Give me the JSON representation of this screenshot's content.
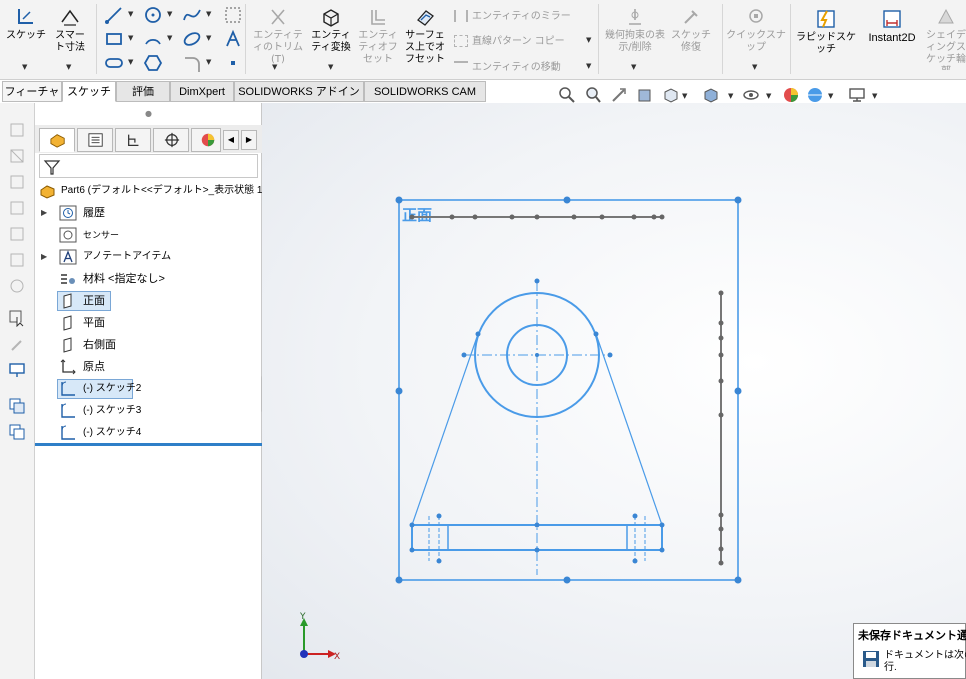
{
  "ribbon": {
    "sketch": "スケッチ",
    "smart_dim": "スマート寸法",
    "trim": "エンティティのトリム(T)",
    "convert": "エンティティ変換",
    "offset_ent": "エンティティオフセット",
    "surface_offset": "サーフェス上でオフセット",
    "mirror": "エンティティのミラー",
    "linear_pattern": "直線パターン コピー",
    "move": "エンティティの移動",
    "relations": "幾何拘束の表示/削除",
    "repair": "スケッチ修復",
    "quick_snap": "クイックスナップ",
    "rapid_sketch": "ラピッドスケッチ",
    "instant2d": "Instant2D",
    "shaded": "シェイディングスケッチ輪郭"
  },
  "tabs": [
    {
      "label": "フィーチャー"
    },
    {
      "label": "スケッチ"
    },
    {
      "label": "評価"
    },
    {
      "label": "DimXpert"
    },
    {
      "label": "SOLIDWORKS アドイン"
    },
    {
      "label": "SOLIDWORKS CAM"
    }
  ],
  "tree": {
    "part": "Part6 (デフォルト<<デフォルト>_表示状態 1>)",
    "items": [
      {
        "label": "履歴"
      },
      {
        "label": "センサー"
      },
      {
        "label": "アノテートアイテム"
      },
      {
        "label": "材料 <指定なし>"
      },
      {
        "label": "正面"
      },
      {
        "label": "平面"
      },
      {
        "label": "右側面"
      },
      {
        "label": "原点"
      },
      {
        "label": "(-) スケッチ2"
      },
      {
        "label": "(-) スケッチ3"
      },
      {
        "label": "(-) スケッチ4"
      }
    ]
  },
  "graphics": {
    "plane_label": "正面",
    "axis_x": "X",
    "axis_y": "Y"
  },
  "notification": {
    "title": "未保存ドキュメント通知",
    "body_line1": "ドキュメントは次の",
    "body_line2": "行."
  },
  "colors": {
    "sketch_blue": "#4a9be8",
    "sketch_gray": "#6e6e6e",
    "selection": "#cfe3f7"
  }
}
